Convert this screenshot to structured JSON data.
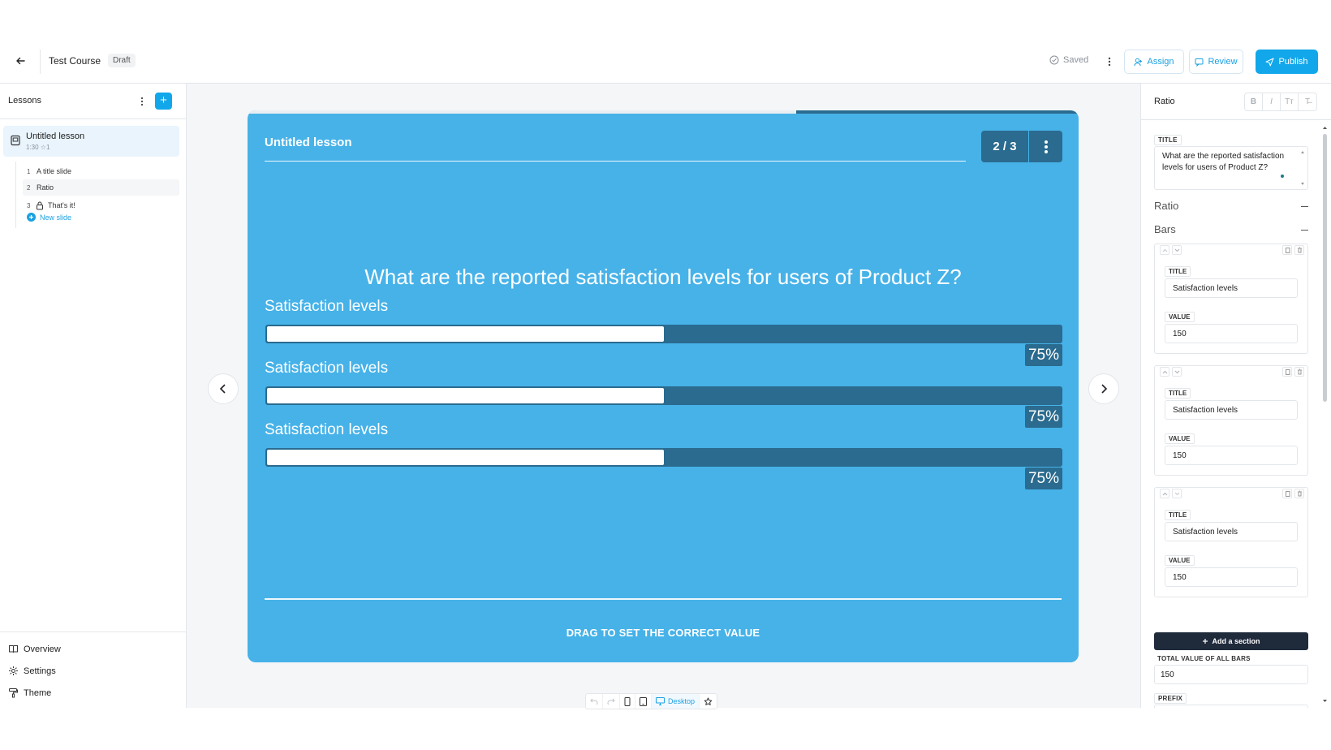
{
  "header": {
    "course_title": "Test Course",
    "status_badge": "Draft",
    "saved_label": "Saved",
    "assign_label": "Assign",
    "review_label": "Review",
    "publish_label": "Publish"
  },
  "sidebar": {
    "title": "Lessons",
    "add_label": "+",
    "lesson": {
      "name": "Untitled lesson",
      "meta": "1:30 ☆1"
    },
    "slides": [
      {
        "num": "1",
        "label": "A title slide"
      },
      {
        "num": "2",
        "label": "Ratio"
      },
      {
        "num": "3",
        "label": "That's it!"
      }
    ],
    "new_slide_label": "New slide",
    "nav": [
      {
        "label": "Overview"
      },
      {
        "label": "Settings"
      },
      {
        "label": "Theme"
      }
    ]
  },
  "slide": {
    "lesson_title": "Untitled lesson",
    "counter": "2 / 3",
    "progress": 0.66,
    "question": "What are the reported satisfaction levels for users of Product Z?",
    "bars": [
      {
        "title": "Satisfaction levels",
        "value_label": "75%",
        "fraction": 0.5
      },
      {
        "title": "Satisfaction levels",
        "value_label": "75%",
        "fraction": 0.5
      },
      {
        "title": "Satisfaction levels",
        "value_label": "75%",
        "fraction": 0.5
      }
    ],
    "hint": "DRAG TO SET THE CORRECT VALUE"
  },
  "device_bar": {
    "desktop_label": "Desktop"
  },
  "panel": {
    "title": "Ratio",
    "format_buttons": [
      "B",
      "I",
      "Tт",
      "T̶"
    ],
    "title_label": "TITLE",
    "title_value": "What are the reported satisfaction levels for users of Product Z?",
    "ratio_label": "Ratio",
    "bars_label": "Bars",
    "bar_cards": [
      {
        "title_label": "TITLE",
        "title_value": "Satisfaction levels",
        "value_label": "VALUE",
        "value": "150"
      },
      {
        "title_label": "TITLE",
        "title_value": "Satisfaction levels",
        "value_label": "VALUE",
        "value": "150"
      },
      {
        "title_label": "TITLE",
        "title_value": "Satisfaction levels",
        "value_label": "VALUE",
        "value": "150"
      }
    ],
    "add_section_label": "Add a section",
    "total_label": "TOTAL VALUE OF ALL BARS",
    "total_value": "150",
    "prefix_label": "PREFIX",
    "prefix_value": ""
  },
  "colors": {
    "accent": "#12a7ea",
    "slide_bg": "#46b2e8",
    "slide_dark": "#2a6b8f",
    "add_section_bg": "#1f2a3b"
  }
}
